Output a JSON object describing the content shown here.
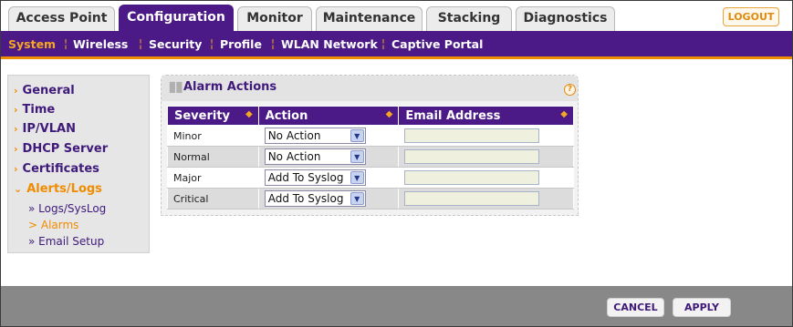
{
  "tabs": [
    {
      "label": "Access Point",
      "active": false
    },
    {
      "label": "Configuration",
      "active": true
    },
    {
      "label": "Monitor",
      "active": false
    },
    {
      "label": "Maintenance",
      "active": false
    },
    {
      "label": "Stacking",
      "active": false
    },
    {
      "label": "Diagnostics",
      "active": false
    }
  ],
  "logout_label": "LOGOUT",
  "subnav": [
    {
      "label": "System",
      "active": true
    },
    {
      "label": "Wireless",
      "active": false
    },
    {
      "label": "Security",
      "active": false
    },
    {
      "label": "Profile",
      "active": false
    },
    {
      "label": "WLAN Network",
      "active": false
    },
    {
      "label": "Captive Portal",
      "active": false
    }
  ],
  "leftnav": {
    "items": [
      {
        "label": "General"
      },
      {
        "label": "Time"
      },
      {
        "label": "IP/VLAN"
      },
      {
        "label": "DHCP Server"
      },
      {
        "label": "Certificates"
      },
      {
        "label": "Alerts/Logs",
        "open": true
      }
    ],
    "subitems": [
      {
        "label": "» Logs/SysLog",
        "active": false
      },
      {
        "label": "> Alarms",
        "active": true
      },
      {
        "label": "» Email Setup",
        "active": false
      }
    ]
  },
  "panel": {
    "title": "Alarm Actions",
    "columns": [
      "Severity",
      "Action",
      "Email Address"
    ],
    "rows": [
      {
        "severity": "Minor",
        "action": "No Action",
        "email": ""
      },
      {
        "severity": "Normal",
        "action": "No Action",
        "email": ""
      },
      {
        "severity": "Major",
        "action": "Add To Syslog",
        "email": ""
      },
      {
        "severity": "Critical",
        "action": "Add To Syslog",
        "email": ""
      }
    ]
  },
  "footer": {
    "cancel_label": "CANCEL",
    "apply_label": "APPLY"
  },
  "colors": {
    "brand_purple": "#4b1a87",
    "accent_orange": "#f08c00"
  },
  "icons": {
    "help": "help-icon",
    "dropdown": "chevron-down-icon",
    "sort": "sort-icon"
  }
}
